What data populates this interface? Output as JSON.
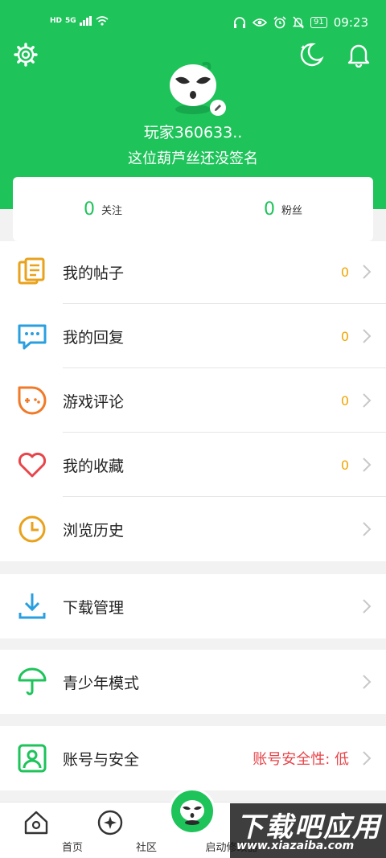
{
  "status_bar": {
    "network_left": "HD",
    "signal_label": "5G",
    "battery": "91",
    "time": "09:23"
  },
  "header": {
    "username": "玩家360633..",
    "signature": "这位葫芦丝还没签名",
    "icons": [
      "settings-gear-icon",
      "night-mode-moon-icon",
      "notification-bell-icon"
    ]
  },
  "stats": {
    "following": {
      "count": "0",
      "label": "关注"
    },
    "followers": {
      "count": "0",
      "label": "粉丝"
    }
  },
  "menu": {
    "posts": {
      "label": "我的帖子",
      "count": "0"
    },
    "replies": {
      "label": "我的回复",
      "count": "0"
    },
    "game_reviews": {
      "label": "游戏评论",
      "count": "0"
    },
    "favorites": {
      "label": "我的收藏",
      "count": "0"
    },
    "history": {
      "label": "浏览历史"
    },
    "downloads": {
      "label": "下载管理"
    },
    "teen_mode": {
      "label": "青少年模式"
    },
    "account": {
      "label": "账号与安全",
      "status": "账号安全性: 低"
    }
  },
  "tabbar": {
    "home": "首页",
    "community": "社区",
    "launcher": "启动修改器"
  },
  "watermark": {
    "title": "下载吧应用",
    "url": "www.xiazaiba.com"
  },
  "colors": {
    "brand_green": "#1ec35a",
    "count_orange": "#f0a500",
    "warning_red": "#e8454a"
  }
}
